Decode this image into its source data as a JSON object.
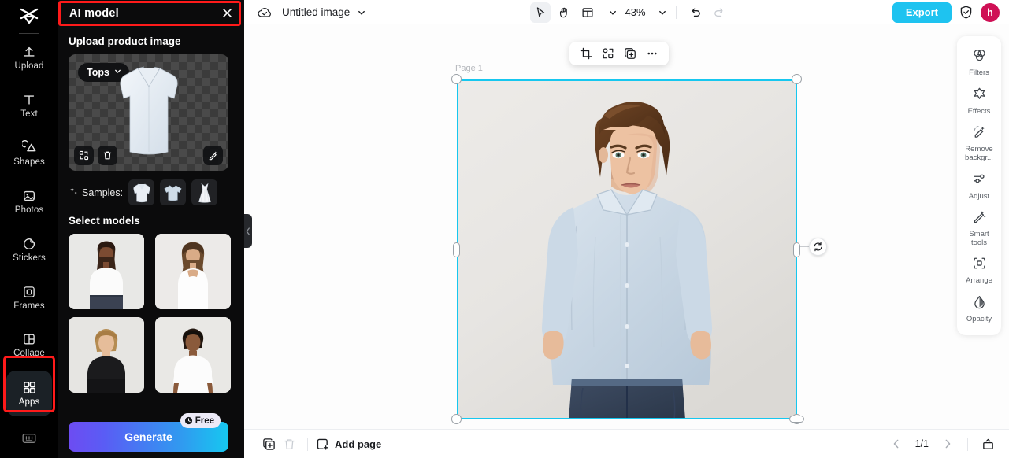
{
  "app": {
    "logo_icon": "capcut-logo-icon"
  },
  "rail": {
    "items": [
      {
        "label": "Upload",
        "icon": "upload-icon",
        "active": false
      },
      {
        "label": "Text",
        "icon": "text-icon",
        "active": false
      },
      {
        "label": "Shapes",
        "icon": "shapes-icon",
        "active": false
      },
      {
        "label": "Photos",
        "icon": "photos-icon",
        "active": false
      },
      {
        "label": "Stickers",
        "icon": "stickers-icon",
        "active": false
      },
      {
        "label": "Frames",
        "icon": "frames-icon",
        "active": false
      },
      {
        "label": "Collage",
        "icon": "collage-icon",
        "active": false
      },
      {
        "label": "Apps",
        "icon": "apps-grid-icon",
        "active": true
      }
    ],
    "bottom_icon": "keyboard-shortcuts-icon"
  },
  "panel": {
    "title": "AI model",
    "close_icon": "close-icon",
    "upload_section_title": "Upload product image",
    "category": {
      "value": "Tops",
      "chevron_icon": "chevron-down-icon"
    },
    "card_tools": [
      {
        "name": "replace-image-icon",
        "icon": "replace-icon"
      },
      {
        "name": "delete-image-icon",
        "icon": "trash-icon"
      },
      {
        "name": "edit-image-icon",
        "icon": "magic-edit-icon"
      }
    ],
    "samples_label": "Samples:",
    "samples_sparkle_icon": "sparkle-icon",
    "samples": [
      {
        "name": "sample-shirt",
        "alt": "long-sleeve shirt"
      },
      {
        "name": "sample-tshirt",
        "alt": "t-shirt"
      },
      {
        "name": "sample-dress",
        "alt": "dress"
      }
    ],
    "models_section_title": "Select models",
    "models": [
      {
        "name": "model-1",
        "alt": "female model in white sleeveless top"
      },
      {
        "name": "model-2",
        "alt": "female model in white tank top"
      },
      {
        "name": "model-3",
        "alt": "male model in black sweater"
      },
      {
        "name": "model-4",
        "alt": "male model in white t-shirt"
      }
    ],
    "generate_label": "Generate",
    "free_badge": {
      "label": "Free",
      "icon": "clock-icon"
    },
    "collapse_icon": "chevron-left-icon"
  },
  "topbar": {
    "cloud_icon": "cloud-saved-icon",
    "doc_name": "Untitled image",
    "doc_chevron_icon": "chevron-down-icon",
    "tools": [
      {
        "name": "select-tool",
        "icon": "cursor-icon",
        "selected": true
      },
      {
        "name": "hand-tool",
        "icon": "hand-icon",
        "selected": false
      },
      {
        "name": "layout-tool",
        "icon": "layout-icon",
        "selected": false
      }
    ],
    "layout_chevron_icon": "chevron-down-icon",
    "zoom": "43%",
    "zoom_chevron_icon": "chevron-down-icon",
    "undo_icon": "undo-icon",
    "redo_icon": "redo-icon",
    "export_label": "Export",
    "shield_icon": "shield-check-icon",
    "avatar_initial": "h"
  },
  "canvas": {
    "page_label": "Page 1",
    "float_tools": [
      {
        "name": "crop-button",
        "icon": "crop-icon"
      },
      {
        "name": "remove-bg-button",
        "icon": "cutout-icon"
      },
      {
        "name": "duplicate-button",
        "icon": "duplicate-icon"
      },
      {
        "name": "more-button",
        "icon": "more-horizontal-icon"
      }
    ],
    "rotate_icon": "rotate-icon",
    "selection_color": "#16c7ef"
  },
  "right_tools": [
    {
      "label": "Filters",
      "icon": "filters-icon"
    },
    {
      "label": "Effects",
      "icon": "effects-icon"
    },
    {
      "label": "Remove\nbackgr...",
      "icon": "remove-background-icon"
    },
    {
      "label": "Adjust",
      "icon": "adjust-icon"
    },
    {
      "label": "Smart\ntools",
      "icon": "smart-tools-icon"
    },
    {
      "label": "Arrange",
      "icon": "arrange-icon"
    },
    {
      "label": "Opacity",
      "icon": "opacity-icon"
    }
  ],
  "bottombar": {
    "duplicate_page_icon": "duplicate-page-icon",
    "delete_page_icon": "trash-icon",
    "add_page_label": "Add page",
    "add_page_icon": "add-page-icon",
    "prev_icon": "chevron-left-icon",
    "page_count": "1/1",
    "next_icon": "chevron-right-icon",
    "present_icon": "present-icon"
  },
  "highlights": {
    "color": "#ff1a1a",
    "targets": [
      "panel-header",
      "sidebar-item-apps"
    ]
  }
}
